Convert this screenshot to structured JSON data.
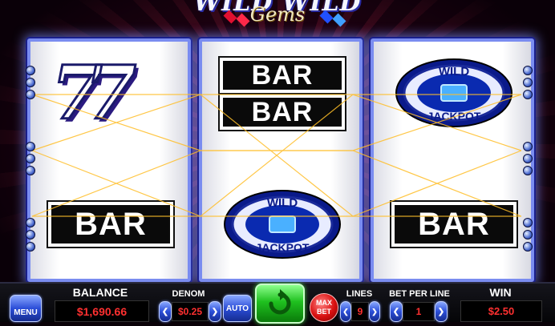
{
  "game": {
    "logo_line1": "WILD WILD",
    "logo_line2": "Gems"
  },
  "reels": [
    {
      "symbols": [
        "7 7",
        "BAR"
      ]
    },
    {
      "symbols": [
        "BAR",
        "BAR",
        "WILD JACKPOT"
      ]
    },
    {
      "symbols": [
        "WILD JACKPOT",
        "BAR"
      ]
    }
  ],
  "symbols": {
    "bar": "BAR",
    "sevens": "77",
    "jackpot_top": "WILD",
    "jackpot_bottom": "JACKPOT"
  },
  "controls": {
    "menu_label": "MENU",
    "balance_label": "BALANCE",
    "balance_value": "$1,690.66",
    "denom_label": "DENOM",
    "denom_value": "$0.25",
    "auto_label": "AUTO",
    "spin_icon": "refresh-icon",
    "maxbet_line1": "MAX",
    "maxbet_line2": "BET",
    "lines_label": "LINES",
    "lines_value": "9",
    "bet_per_line_label": "BET PER LINE",
    "bet_per_line_value": "1",
    "win_label": "WIN",
    "win_value": "$2.50"
  },
  "colors": {
    "reel_border": "#7a8cf0",
    "payline": "#ffbe28",
    "display_text": "#ff3030",
    "spin_green": "#1fc01f"
  }
}
